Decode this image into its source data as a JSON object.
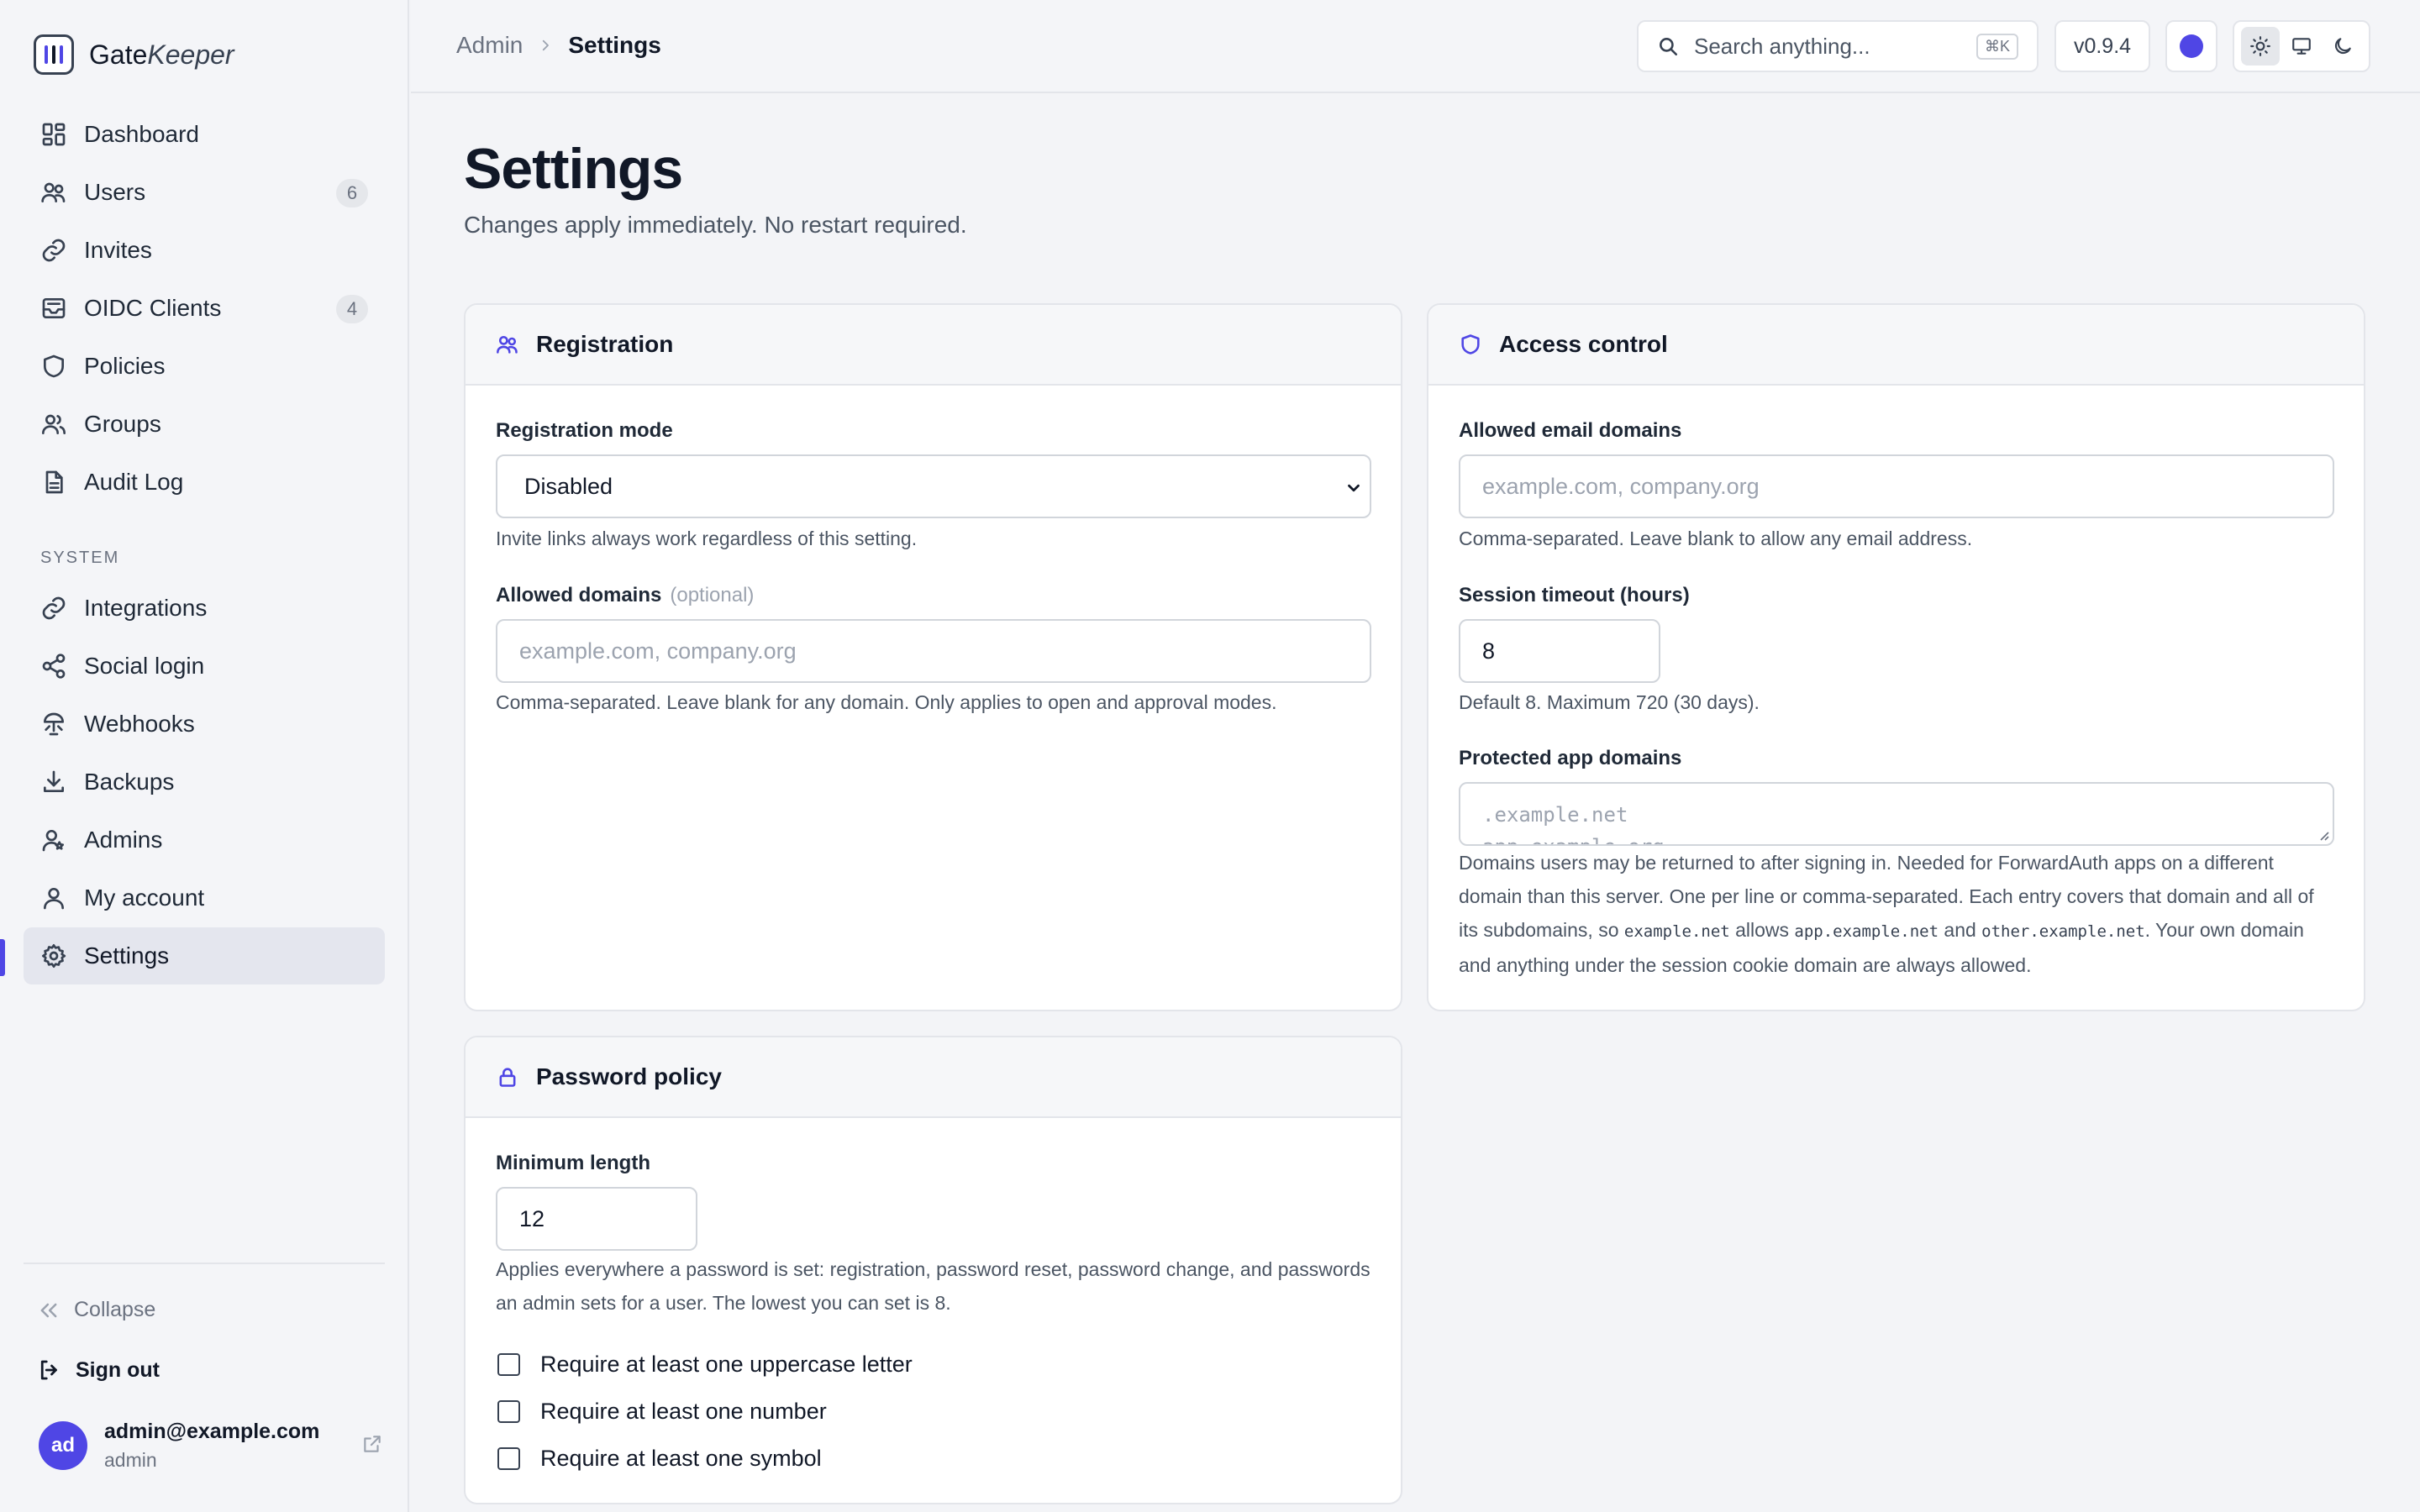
{
  "brand": {
    "name_a": "Gate",
    "name_b": "Keeper"
  },
  "nav": {
    "items": [
      {
        "label": "Dashboard"
      },
      {
        "label": "Users",
        "badge": "6"
      },
      {
        "label": "Invites"
      },
      {
        "label": "OIDC Clients",
        "badge": "4"
      },
      {
        "label": "Policies"
      },
      {
        "label": "Groups"
      },
      {
        "label": "Audit Log"
      }
    ],
    "system_label": "SYSTEM",
    "system_items": [
      {
        "label": "Integrations"
      },
      {
        "label": "Social login"
      },
      {
        "label": "Webhooks"
      },
      {
        "label": "Backups"
      },
      {
        "label": "Admins"
      },
      {
        "label": "My account"
      },
      {
        "label": "Settings",
        "active": true
      }
    ],
    "collapse_label": "Collapse",
    "signout_label": "Sign out"
  },
  "account": {
    "initials": "ad",
    "email": "admin@example.com",
    "role": "admin"
  },
  "topbar": {
    "breadcrumb": [
      "Admin",
      "Settings"
    ],
    "search_placeholder": "Search anything...",
    "search_shortcut": "⌘K",
    "version": "v0.9.4",
    "accent_color": "#4f46e5",
    "theme_active": "light"
  },
  "page": {
    "title": "Settings",
    "subtitle": "Changes apply immediately. No restart required."
  },
  "registration": {
    "title": "Registration",
    "mode_label": "Registration mode",
    "mode_value": "Disabled",
    "mode_help": "Invite links always work regardless of this setting.",
    "domains_label": "Allowed domains",
    "domains_optional": "(optional)",
    "domains_placeholder": "example.com, company.org",
    "domains_help": "Comma-separated. Leave blank for any domain. Only applies to open and approval modes."
  },
  "access": {
    "title": "Access control",
    "email_domains_label": "Allowed email domains",
    "email_domains_placeholder": "example.com, company.org",
    "email_domains_help": "Comma-separated. Leave blank to allow any email address.",
    "timeout_label": "Session timeout (hours)",
    "timeout_value": "8",
    "timeout_help": "Default 8. Maximum 720 (30 days).",
    "protected_label": "Protected app domains",
    "protected_placeholder_1": ".example.net",
    "protected_placeholder_2": "app.example.org",
    "protected_help_1": "Domains users may be returned to after signing in. Needed for ForwardAuth apps on a different domain than this server. One per line or comma-separated. Each entry covers that domain and all of its subdomains, so ",
    "protected_help_code1": "example.net",
    "protected_help_2": " allows ",
    "protected_help_code2": "app.example.net",
    "protected_help_3": " and ",
    "protected_help_code3": "other.example.net",
    "protected_help_4": ". Your own domain and anything under the session cookie domain are always allowed."
  },
  "password": {
    "title": "Password policy",
    "min_label": "Minimum length",
    "min_value": "12",
    "min_help": "Applies everywhere a password is set: registration, password reset, password change, and passwords an admin sets for a user. The lowest you can set is 8.",
    "checks": [
      {
        "label": "Require at least one uppercase letter",
        "checked": false
      },
      {
        "label": "Require at least one number",
        "checked": false
      },
      {
        "label": "Require at least one symbol",
        "checked": false
      }
    ]
  }
}
